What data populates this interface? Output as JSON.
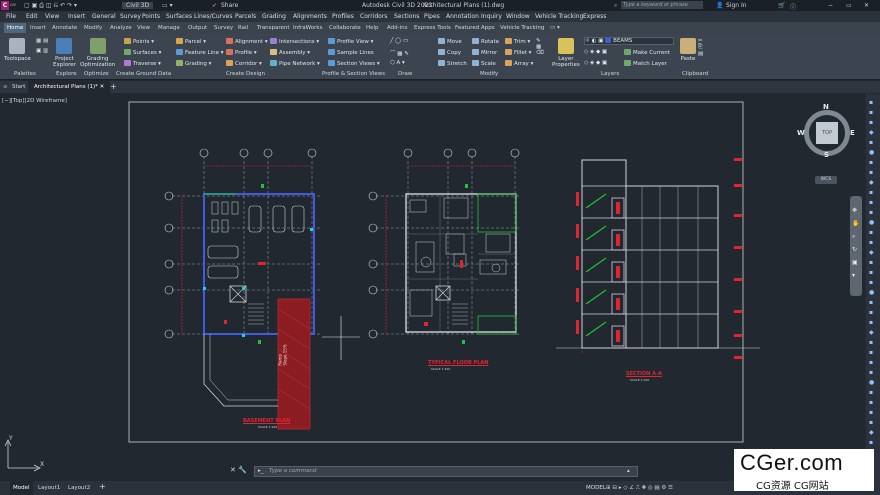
{
  "app": {
    "logo": "C",
    "logo_suffix": "CIV",
    "product_dropdown": "Civil 3D",
    "share_label": "Share",
    "title": "Autodesk Civil 3D 2023",
    "filename": "Architectural Plans (1).dwg",
    "search_placeholder": "Type a keyword or phrase",
    "sign_in": "Sign In"
  },
  "menu": [
    "File",
    "Edit",
    "View",
    "Insert",
    "General",
    "Survey",
    "Points",
    "Surfaces",
    "Lines/Curves",
    "Parcels",
    "Grading",
    "Alignments",
    "Profiles",
    "Corridors",
    "Sections",
    "Pipes",
    "Annotation",
    "Inquiry",
    "Window",
    "Vehicle Tracking",
    "Express"
  ],
  "ribbon_tabs": [
    "Home",
    "Insert",
    "Annotate",
    "Modify",
    "Analyze",
    "View",
    "Manage",
    "Output",
    "Survey",
    "Rail",
    "Transparent",
    "InfraWorks",
    "Collaborate",
    "Help",
    "Add-ins",
    "Express Tools",
    "Featured Apps",
    "Vehicle Tracking"
  ],
  "ribbon": {
    "toolspace": "Toolspace",
    "project_explorer_1": "Project",
    "project_explorer_2": "Explorer",
    "grading_opt_1": "Grading",
    "grading_opt_2": "Optimization",
    "points": "Points",
    "surfaces": "Surfaces",
    "traverse": "Traverse",
    "parcel": "Parcel",
    "feature_line": "Feature Line",
    "grading": "Grading",
    "alignment": "Alignment",
    "profile": "Profile",
    "corridor": "Corridor",
    "intersections": "Intersections",
    "assembly": "Assembly",
    "pipe_network": "Pipe Network",
    "profile_view": "Profile View",
    "sample_lines": "Sample Lines",
    "section_views": "Section Views",
    "move": "Move",
    "copy": "Copy",
    "stretch": "Stretch",
    "rotate": "Rotate",
    "mirror": "Mirror",
    "scale": "Scale",
    "trim": "Trim",
    "fillet": "Fillet",
    "array": "Array",
    "layer_properties_1": "Layer",
    "layer_properties_2": "Properties",
    "layer_name": "BEAMS",
    "make_current": "Make Current",
    "match_layer": "Match Layer",
    "paste": "Paste",
    "panels": {
      "palettes": "Palettes",
      "explore": "Explore",
      "optimize": "Optimize",
      "ground": "Create Ground Data",
      "design": "Create Design",
      "profile_section": "Profile & Section Views",
      "draw": "Draw",
      "modify": "Modify",
      "layers": "Layers",
      "clipboard": "Clipboard"
    }
  },
  "doc_tabs": {
    "start": "Start",
    "active": "Architectural Plans (1)*"
  },
  "viewport_label": "[−][Top][2D Wireframe]",
  "viewcube": {
    "top": "TOP",
    "n": "N",
    "s": "S",
    "e": "E",
    "w": "W",
    "wcs": "WCS"
  },
  "drawings": {
    "basement": "BASEMENT PLAN",
    "typical": "TYPICAL FLOOR PLAN",
    "section": "SECTION A-A",
    "scale": "SCALE 1:100",
    "ramp": "Ramp\nSlope 15%"
  },
  "command_placeholder": "Type a command",
  "status": {
    "model": "Model",
    "layout1": "Layout1",
    "layout2": "Layout2",
    "model_right": "MODEL"
  },
  "watermark": {
    "line1": "CGer.com",
    "line2": "CG资源 CG网站"
  },
  "colors": {
    "accent": "#4f6880",
    "bg": "#212830",
    "wall": "#3f5be0",
    "red": "#e02530",
    "green": "#1fc23a"
  }
}
